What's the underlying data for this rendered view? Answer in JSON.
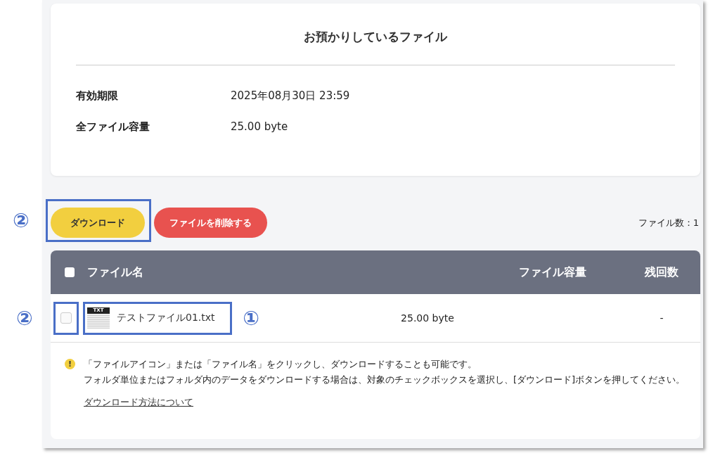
{
  "summary": {
    "title": "お預かりしているファイル",
    "rows": [
      {
        "label": "有効期限",
        "value": "2025年08月30日 23:59"
      },
      {
        "label": "全ファイル容量",
        "value": "25.00 byte"
      }
    ]
  },
  "actions": {
    "download": {
      "label": "ダウンロード",
      "callout": "②"
    },
    "delete": {
      "label": "ファイルを削除する"
    },
    "file_count": "ファイル数：1"
  },
  "table": {
    "columns": [
      "ファイル名",
      "ファイル容量",
      "残回数"
    ],
    "header_checked": false,
    "rows": [
      {
        "checked": false,
        "checkbox_callout": "②",
        "name": "テストファイル01.txt",
        "name_callout": "①",
        "icon_label": "TXT",
        "size": "25.00 byte",
        "remaining": "-"
      }
    ]
  },
  "note": {
    "icon": "!",
    "lines": [
      "「ファイルアイコン」または「ファイル名」をクリックし、ダウンロードすることも可能です。",
      "フォルダ単位またはフォルダ内のデータをダウンロードする場合は、対象のチェックボックスを選択し、[ダウンロード]ボタンを押してください。"
    ],
    "link": "ダウンロード方法について"
  }
}
